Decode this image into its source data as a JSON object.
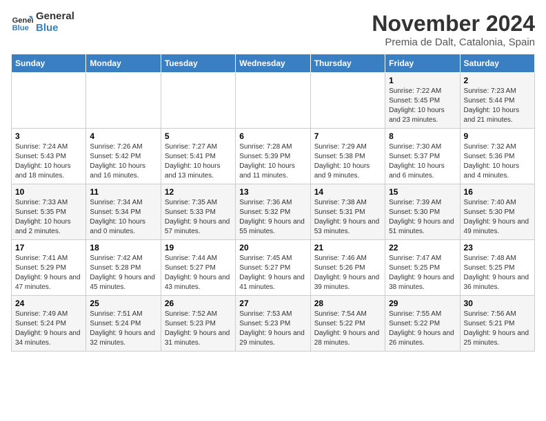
{
  "header": {
    "logo_line1": "General",
    "logo_line2": "Blue",
    "month": "November 2024",
    "location": "Premia de Dalt, Catalonia, Spain"
  },
  "days_of_week": [
    "Sunday",
    "Monday",
    "Tuesday",
    "Wednesday",
    "Thursday",
    "Friday",
    "Saturday"
  ],
  "weeks": [
    [
      {
        "day": "",
        "info": ""
      },
      {
        "day": "",
        "info": ""
      },
      {
        "day": "",
        "info": ""
      },
      {
        "day": "",
        "info": ""
      },
      {
        "day": "",
        "info": ""
      },
      {
        "day": "1",
        "info": "Sunrise: 7:22 AM\nSunset: 5:45 PM\nDaylight: 10 hours and 23 minutes."
      },
      {
        "day": "2",
        "info": "Sunrise: 7:23 AM\nSunset: 5:44 PM\nDaylight: 10 hours and 21 minutes."
      }
    ],
    [
      {
        "day": "3",
        "info": "Sunrise: 7:24 AM\nSunset: 5:43 PM\nDaylight: 10 hours and 18 minutes."
      },
      {
        "day": "4",
        "info": "Sunrise: 7:26 AM\nSunset: 5:42 PM\nDaylight: 10 hours and 16 minutes."
      },
      {
        "day": "5",
        "info": "Sunrise: 7:27 AM\nSunset: 5:41 PM\nDaylight: 10 hours and 13 minutes."
      },
      {
        "day": "6",
        "info": "Sunrise: 7:28 AM\nSunset: 5:39 PM\nDaylight: 10 hours and 11 minutes."
      },
      {
        "day": "7",
        "info": "Sunrise: 7:29 AM\nSunset: 5:38 PM\nDaylight: 10 hours and 9 minutes."
      },
      {
        "day": "8",
        "info": "Sunrise: 7:30 AM\nSunset: 5:37 PM\nDaylight: 10 hours and 6 minutes."
      },
      {
        "day": "9",
        "info": "Sunrise: 7:32 AM\nSunset: 5:36 PM\nDaylight: 10 hours and 4 minutes."
      }
    ],
    [
      {
        "day": "10",
        "info": "Sunrise: 7:33 AM\nSunset: 5:35 PM\nDaylight: 10 hours and 2 minutes."
      },
      {
        "day": "11",
        "info": "Sunrise: 7:34 AM\nSunset: 5:34 PM\nDaylight: 10 hours and 0 minutes."
      },
      {
        "day": "12",
        "info": "Sunrise: 7:35 AM\nSunset: 5:33 PM\nDaylight: 9 hours and 57 minutes."
      },
      {
        "day": "13",
        "info": "Sunrise: 7:36 AM\nSunset: 5:32 PM\nDaylight: 9 hours and 55 minutes."
      },
      {
        "day": "14",
        "info": "Sunrise: 7:38 AM\nSunset: 5:31 PM\nDaylight: 9 hours and 53 minutes."
      },
      {
        "day": "15",
        "info": "Sunrise: 7:39 AM\nSunset: 5:30 PM\nDaylight: 9 hours and 51 minutes."
      },
      {
        "day": "16",
        "info": "Sunrise: 7:40 AM\nSunset: 5:30 PM\nDaylight: 9 hours and 49 minutes."
      }
    ],
    [
      {
        "day": "17",
        "info": "Sunrise: 7:41 AM\nSunset: 5:29 PM\nDaylight: 9 hours and 47 minutes."
      },
      {
        "day": "18",
        "info": "Sunrise: 7:42 AM\nSunset: 5:28 PM\nDaylight: 9 hours and 45 minutes."
      },
      {
        "day": "19",
        "info": "Sunrise: 7:44 AM\nSunset: 5:27 PM\nDaylight: 9 hours and 43 minutes."
      },
      {
        "day": "20",
        "info": "Sunrise: 7:45 AM\nSunset: 5:27 PM\nDaylight: 9 hours and 41 minutes."
      },
      {
        "day": "21",
        "info": "Sunrise: 7:46 AM\nSunset: 5:26 PM\nDaylight: 9 hours and 39 minutes."
      },
      {
        "day": "22",
        "info": "Sunrise: 7:47 AM\nSunset: 5:25 PM\nDaylight: 9 hours and 38 minutes."
      },
      {
        "day": "23",
        "info": "Sunrise: 7:48 AM\nSunset: 5:25 PM\nDaylight: 9 hours and 36 minutes."
      }
    ],
    [
      {
        "day": "24",
        "info": "Sunrise: 7:49 AM\nSunset: 5:24 PM\nDaylight: 9 hours and 34 minutes."
      },
      {
        "day": "25",
        "info": "Sunrise: 7:51 AM\nSunset: 5:24 PM\nDaylight: 9 hours and 32 minutes."
      },
      {
        "day": "26",
        "info": "Sunrise: 7:52 AM\nSunset: 5:23 PM\nDaylight: 9 hours and 31 minutes."
      },
      {
        "day": "27",
        "info": "Sunrise: 7:53 AM\nSunset: 5:23 PM\nDaylight: 9 hours and 29 minutes."
      },
      {
        "day": "28",
        "info": "Sunrise: 7:54 AM\nSunset: 5:22 PM\nDaylight: 9 hours and 28 minutes."
      },
      {
        "day": "29",
        "info": "Sunrise: 7:55 AM\nSunset: 5:22 PM\nDaylight: 9 hours and 26 minutes."
      },
      {
        "day": "30",
        "info": "Sunrise: 7:56 AM\nSunset: 5:21 PM\nDaylight: 9 hours and 25 minutes."
      }
    ]
  ]
}
